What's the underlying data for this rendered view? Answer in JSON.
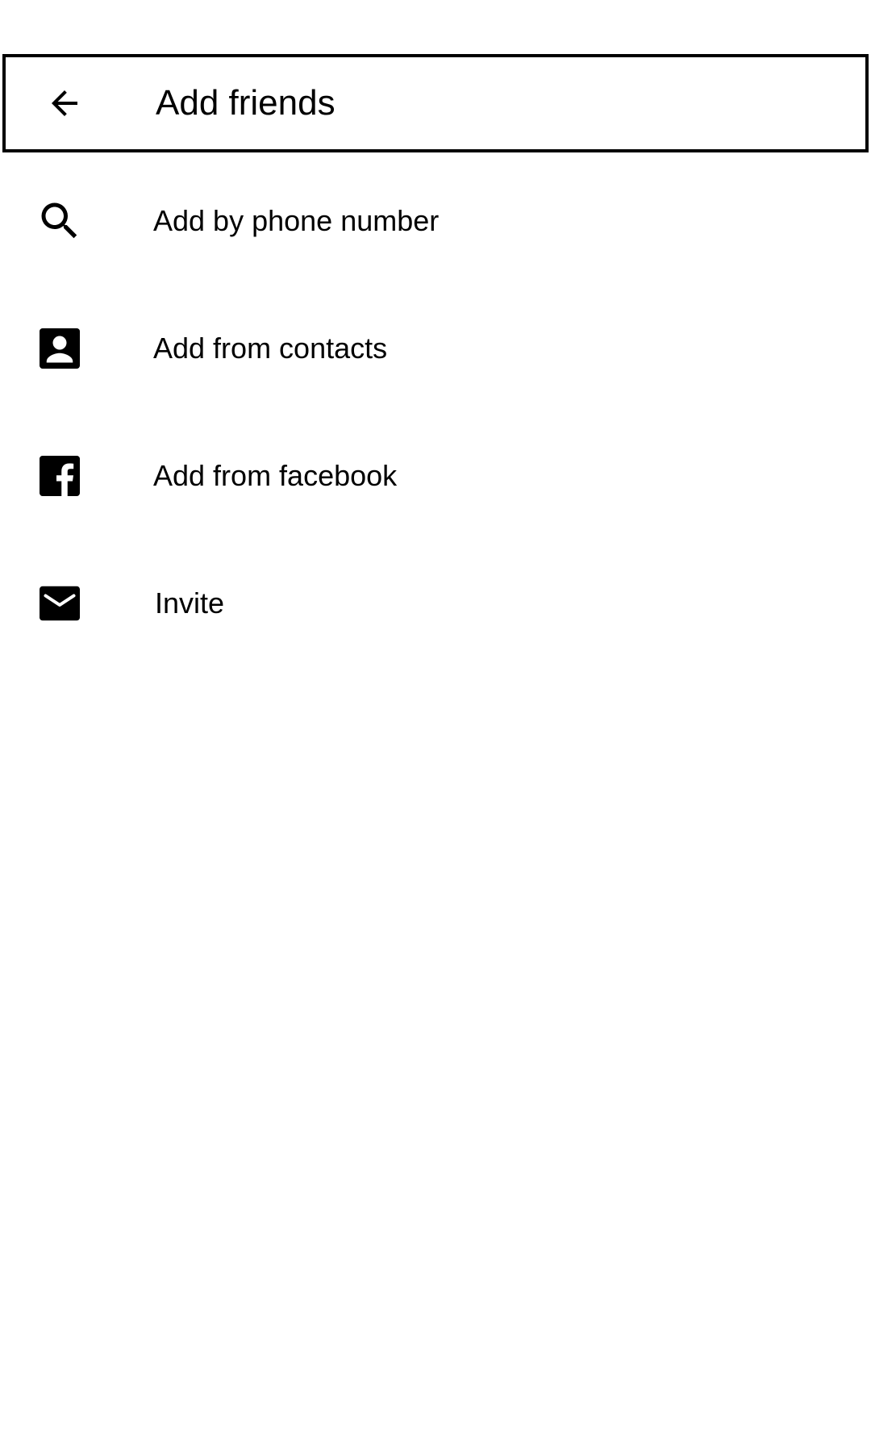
{
  "header": {
    "title": "Add friends",
    "back_icon": "arrow-back-icon"
  },
  "menu": {
    "items": [
      {
        "label": "Add by phone number",
        "icon": "search-icon"
      },
      {
        "label": "Add from contacts",
        "icon": "contact-icon"
      },
      {
        "label": "Add from facebook",
        "icon": "facebook-icon"
      },
      {
        "label": "Invite",
        "icon": "mail-icon"
      }
    ]
  },
  "colors": {
    "background": "#ffffff",
    "foreground": "#000000"
  }
}
